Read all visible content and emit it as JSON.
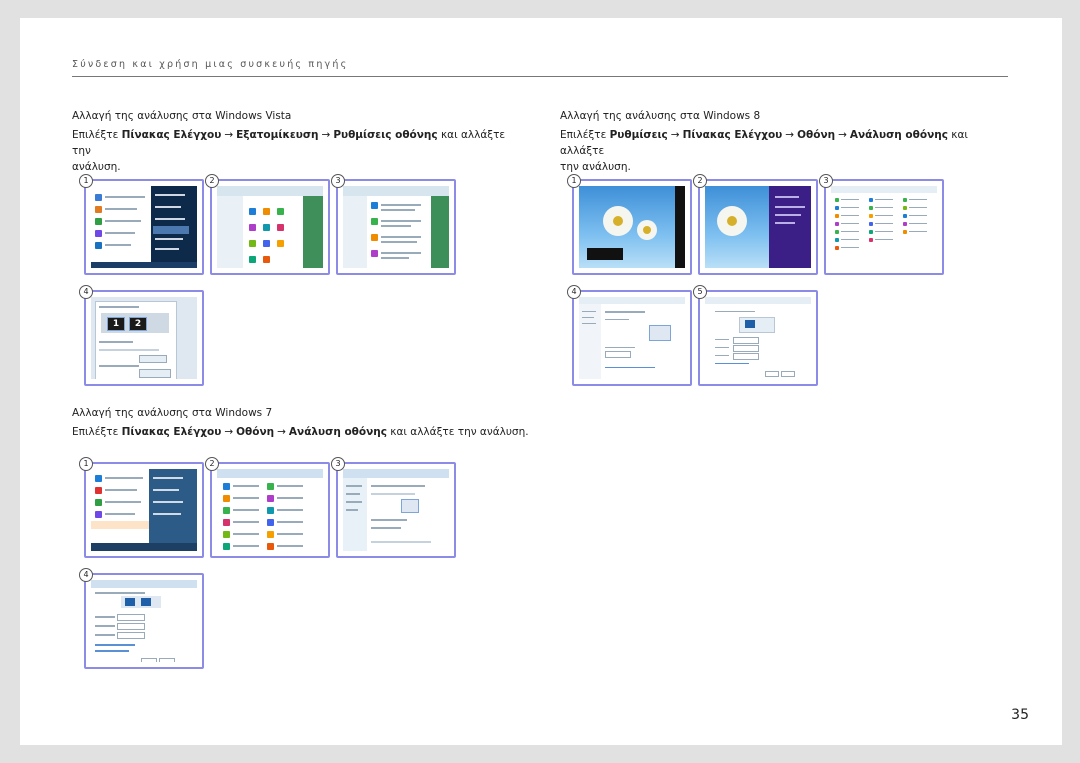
{
  "header": {
    "title": "Σύνδεση και χρήση μιας συσκευής πηγής"
  },
  "vista": {
    "title": "Αλλαγή της ανάλυσης στα Windows Vista",
    "lead": "Επιλέξτε",
    "step1": "Πίνακας Ελέγχου",
    "step2": "Εξατομίκευση",
    "step3": "Ρυθμίσεις οθόνης",
    "tail": "και αλλάξτε την",
    "tail2": "ανάλυση.",
    "arrow": "→",
    "badges": [
      "1",
      "2",
      "3",
      "4"
    ]
  },
  "win8": {
    "title": "Αλλαγή της ανάλυσης στα Windows 8",
    "lead": "Επιλέξτε",
    "step1": "Ρυθμίσεις",
    "step2": "Πίνακας Ελέγχου",
    "step3": "Οθόνη",
    "step4": "Ανάλυση οθόνης",
    "tail": "και αλλάξτε",
    "tail2": "την ανάλυση.",
    "arrow": "→",
    "badges": [
      "1",
      "2",
      "3",
      "4",
      "5"
    ]
  },
  "win7": {
    "title": "Αλλαγή της ανάλυσης στα Windows 7",
    "lead": "Επιλέξτε",
    "step1": "Πίνακας Ελέγχου",
    "step2": "Οθόνη",
    "step3": "Ανάλυση οθόνης",
    "tail": "και αλλάξτε την ανάλυση.",
    "arrow": "→",
    "badges": [
      "1",
      "2",
      "3",
      "4"
    ]
  },
  "monitors": {
    "one": "1",
    "two": "2"
  },
  "footer": {
    "page_number": "35"
  },
  "colors": {
    "frame": "#8c8ce6",
    "rule": "#777777",
    "background": "#e1e1e1"
  }
}
